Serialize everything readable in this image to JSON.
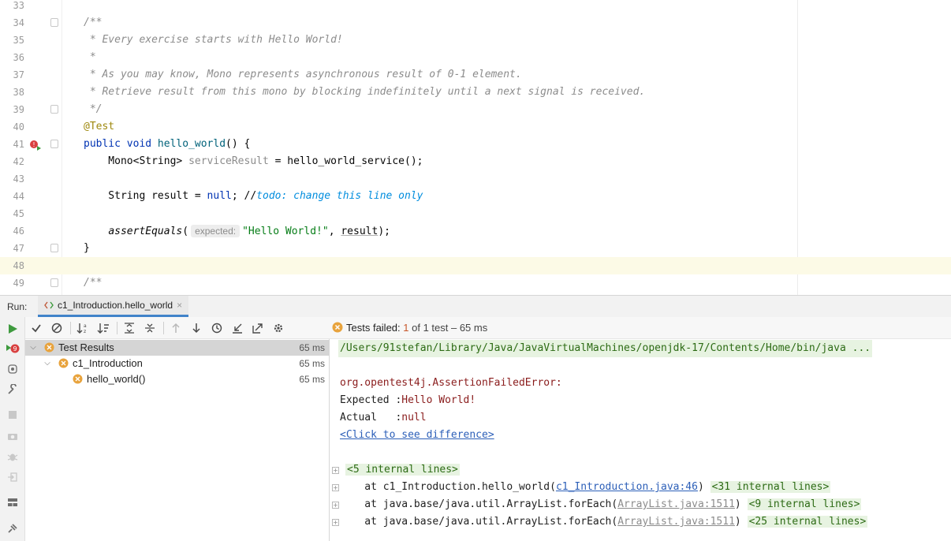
{
  "editor": {
    "lines": [
      {
        "num": "33"
      },
      {
        "num": "34",
        "text": "/**"
      },
      {
        "num": "35",
        "text": " * Every exercise starts with Hello World!"
      },
      {
        "num": "36",
        "text": " *"
      },
      {
        "num": "37",
        "text": " * As you may know, Mono represents asynchronous result of 0-1 element."
      },
      {
        "num": "38",
        "text": " * Retrieve result from this mono by blocking indefinitely until a next signal is received."
      },
      {
        "num": "39",
        "text": " */"
      },
      {
        "num": "40",
        "text": "@Test"
      },
      {
        "num": "41",
        "kw": "public void ",
        "fn": "hello_world",
        "rest": "() {"
      },
      {
        "num": "42",
        "t1": "    Mono<String> ",
        "t2": "serviceResult",
        "t3": " = hello_world_service();"
      },
      {
        "num": "43"
      },
      {
        "num": "44",
        "t1": "    String result = ",
        "kw": "null",
        "t2": "; //",
        "todo": "todo: change this line only"
      },
      {
        "num": "45"
      },
      {
        "num": "46",
        "t1": "    ",
        "call": "assertEquals",
        "t2": "(",
        "hint": "expected:",
        "str": "\"Hello World!\"",
        "t3": ", ",
        "var": "result",
        "t4": ");"
      },
      {
        "num": "47",
        "text": "}"
      },
      {
        "num": "48"
      },
      {
        "num": "49",
        "text": "/**"
      }
    ]
  },
  "run": {
    "label": "Run:",
    "tab_label": "c1_Introduction.hello_world",
    "close_glyph": "×",
    "status": {
      "prefix": "Tests failed: ",
      "failed": "1",
      "suffix": " of 1 test – 65 ms"
    }
  },
  "tree": [
    {
      "label": "Test Results",
      "time": "65 ms"
    },
    {
      "label": "c1_Introduction",
      "time": "65 ms"
    },
    {
      "label": "hello_world()",
      "time": "65 ms"
    }
  ],
  "console": {
    "command": "/Users/91stefan/Library/Java/JavaVirtualMachines/openjdk-17/Contents/Home/bin/java ...",
    "error": "org.opentest4j.AssertionFailedError:",
    "expected_label": "Expected :",
    "expected_value": "Hello World!",
    "actual_label": "Actual   :",
    "actual_value": "null",
    "diff_link": "<Click to see difference>",
    "internal1": "<5 internal lines>",
    "trace1_a": "    at c1_Introduction.hello_world(",
    "trace1_link": "c1_Introduction.java:46",
    "trace1_b": ") ",
    "trace1_internal": "<31 internal lines>",
    "trace2_a": "    at java.base/java.util.ArrayList.forEach(",
    "trace2_link": "ArrayList.java:1511",
    "trace2_b": ") ",
    "trace2_internal": "<9 internal lines>",
    "trace3_a": "    at java.base/java.util.ArrayList.forEach(",
    "trace3_link": "ArrayList.java:1511",
    "trace3_b": ") ",
    "trace3_internal": "<25 internal lines>"
  },
  "icons": {
    "toolbar": [
      "check-icon",
      "cancel-icon",
      "sort-alpha-icon",
      "sort-duration-icon",
      "expand-all-icon",
      "collapse-all-icon",
      "prev-failed-icon",
      "next-failed-icon",
      "history-icon",
      "import-tests-icon",
      "export-tests-icon",
      "settings-icon"
    ],
    "strip": [
      "run-icon",
      "rerun-failed-icon",
      "toggle-auto-test-icon",
      "wrench-icon",
      "stop-icon",
      "camera-icon",
      "debug-icon",
      "exit-icon",
      "layout-icon",
      "pin-icon"
    ]
  },
  "colors": {
    "accent": "#4083c9",
    "fail": "#e8a33d",
    "run_green": "#3e9a3e",
    "error_red": "#d94040"
  }
}
